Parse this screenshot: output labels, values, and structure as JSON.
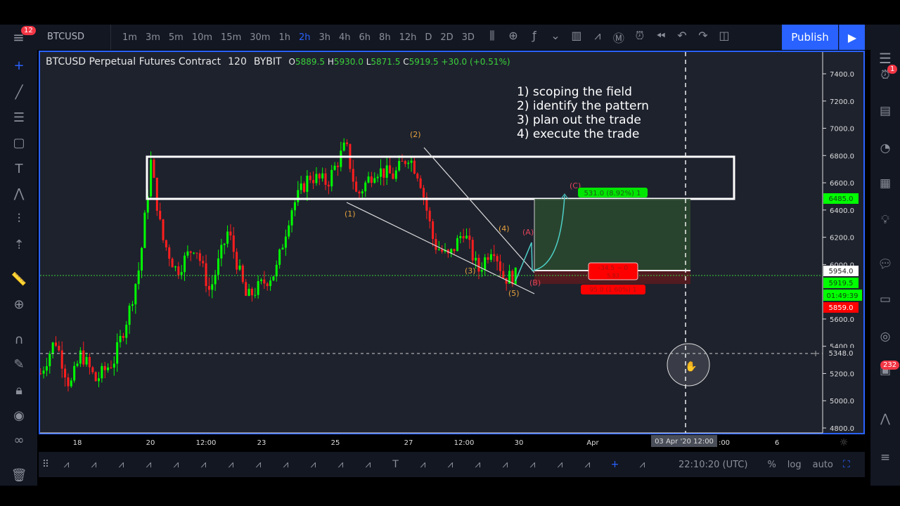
{
  "toolbar": {
    "symbol": "BTCUSD",
    "menu_badge": "12",
    "timeframes": [
      "1m",
      "3m",
      "5m",
      "10m",
      "15m",
      "30m",
      "1h",
      "2h",
      "3h",
      "4h",
      "6h",
      "8h",
      "12h",
      "D",
      "2D",
      "3D"
    ],
    "active_timeframe": "2h",
    "icons": [
      "bar-style-icon",
      "indicator-add-icon",
      "fx-icon",
      "chevron-down-icon",
      "compare-icon",
      "templates-icon",
      "m-icon",
      "alert-icon",
      "replay-icon",
      "undo-icon",
      "redo-icon",
      "layout-icon"
    ],
    "publish_label": "Publish"
  },
  "legend": {
    "title": "BTCUSD Perpetual Futures Contract",
    "interval": "120",
    "exchange": "BYBIT",
    "o_label": "O",
    "o": "5889.5",
    "h_label": "H",
    "h": "5930.0",
    "l_label": "L",
    "l": "5871.5",
    "c_label": "C",
    "c": "5919.5",
    "change": "+30.0 (+0.51%)"
  },
  "notes": [
    "1) scoping the field",
    "2) identify the pattern",
    "3) plan out the trade",
    "4) execute the trade"
  ],
  "wave_labels": {
    "w1": "(1)",
    "w2": "(2)",
    "w3": "(3)",
    "w4": "(4)",
    "w5": "(5)",
    "A": "(A)",
    "B": "(B)",
    "C": "(C)"
  },
  "position": {
    "target": "531.0 (8.92%) 1",
    "entry": "-34.5 ~ 0",
    "entry_sub": "5.83",
    "stop": "95.0 (1.60%) 1"
  },
  "price_axis": {
    "ticks": [
      "7400.0",
      "7200.0",
      "7000.0",
      "6800.0",
      "6600.0",
      "6400.0",
      "6200.0",
      "6000.0",
      "5600.0",
      "5400.0",
      "5200.0",
      "5000.0",
      "4800.0"
    ],
    "tick_values": [
      7400,
      7200,
      7000,
      6800,
      6600,
      6400,
      6200,
      6000,
      5600,
      5400,
      5200,
      5000,
      4800
    ],
    "target_label": "6485.0",
    "entry_label": "5954.0",
    "last_price": "5919.5",
    "countdown": "01:49:39",
    "stop_label": "5859.0",
    "crosshair_price": "5348.0"
  },
  "time_axis": {
    "ticks": [
      "18",
      "20",
      "12:00",
      "23",
      "25",
      "27",
      "12:00",
      "30",
      "Apr",
      ":00",
      "6"
    ],
    "crosshair_time": "03 Apr '20  12:00"
  },
  "price_path": [
    [
      17.0,
      5200
    ],
    [
      17.4,
      5450
    ],
    [
      17.8,
      5100
    ],
    [
      18.1,
      5350
    ],
    [
      18.5,
      5150
    ],
    [
      19.0,
      5300
    ],
    [
      19.4,
      5650
    ],
    [
      19.7,
      6000
    ],
    [
      20.0,
      6750
    ],
    [
      20.3,
      6200
    ],
    [
      20.7,
      5950
    ],
    [
      21.2,
      6150
    ],
    [
      21.6,
      5800
    ],
    [
      22.1,
      6250
    ],
    [
      22.6,
      5750
    ],
    [
      23.0,
      5850
    ],
    [
      23.4,
      5950
    ],
    [
      23.8,
      6400
    ],
    [
      24.3,
      6650
    ],
    [
      24.8,
      6600
    ],
    [
      25.3,
      6880
    ],
    [
      25.6,
      6500
    ],
    [
      26.1,
      6700
    ],
    [
      26.6,
      6650
    ],
    [
      27.0,
      6800
    ],
    [
      27.3,
      6650
    ],
    [
      27.7,
      6150
    ],
    [
      28.1,
      6050
    ],
    [
      28.5,
      6250
    ],
    [
      28.9,
      5950
    ],
    [
      29.3,
      6150
    ],
    [
      29.6,
      5900
    ],
    [
      29.95,
      5920
    ]
  ],
  "colors": {
    "up": "#00ff00",
    "down": "#ff1e1e",
    "accent": "#2962ff",
    "target": "#00e600",
    "stop": "#ff0000",
    "wave_num": "#e6a23c",
    "wave_letter": "#e0455a",
    "cyan": "#4dd0c8"
  },
  "bottom": {
    "clock": "22:10:20 (UTC)",
    "percent": "%",
    "log": "log",
    "auto": "auto"
  },
  "right_badges": {
    "alerts": "1",
    "chat": "232"
  }
}
